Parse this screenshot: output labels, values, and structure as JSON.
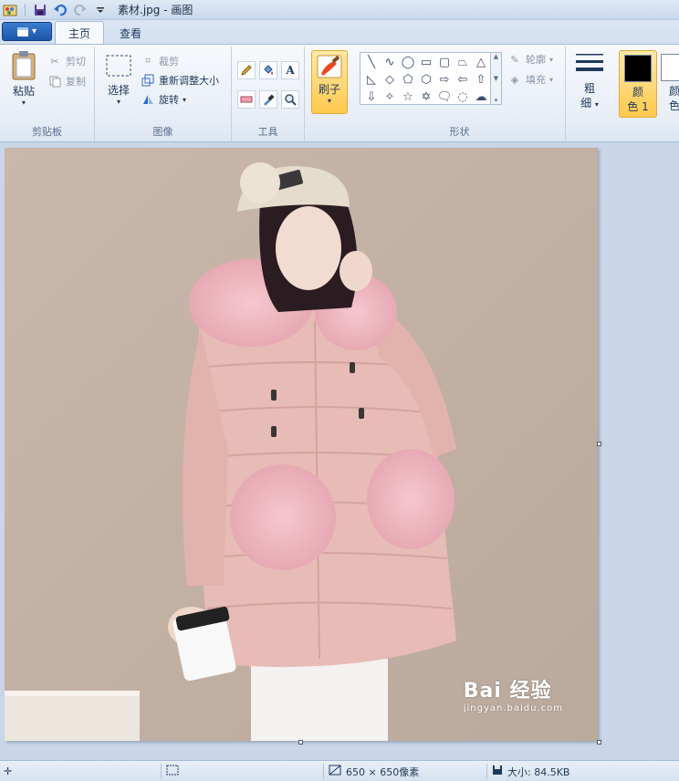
{
  "titlebar": {
    "title": "素材.jpg - 画图",
    "icons": [
      "paint-app-icon",
      "save-icon",
      "undo-icon",
      "redo-icon",
      "customize-dropdown-icon"
    ]
  },
  "tabs": [
    {
      "label": "主页",
      "active": true
    },
    {
      "label": "查看",
      "active": false
    }
  ],
  "ribbon": {
    "clipboard": {
      "group_label": "剪贴板",
      "paste": "粘贴",
      "cut": "剪切",
      "copy": "复制"
    },
    "image": {
      "group_label": "图像",
      "select": "选择",
      "crop": "裁剪",
      "resize": "重新调整大小",
      "rotate": "旋转"
    },
    "tools": {
      "group_label": "工具",
      "items": [
        "pencil-icon",
        "fill-icon",
        "text-icon",
        "eraser-icon",
        "color-picker-icon",
        "magnifier-icon"
      ]
    },
    "brushes": {
      "label": "刷子"
    },
    "shapes": {
      "group_label": "形状",
      "outline": "轮廓",
      "fill": "填充"
    },
    "size": {
      "label_line1": "粗",
      "label_line2": "细"
    },
    "color1": {
      "label_line1": "颜",
      "label_line2": "色 1",
      "color": "#000000"
    },
    "color2": {
      "label_line1": "颜",
      "label_line2": "色",
      "color": "#ffffff"
    }
  },
  "statusbar": {
    "dimensions": "650 × 650像素",
    "size": "大小: 84.5KB"
  },
  "watermark": {
    "main": "Bai 经验",
    "sub": "jingyan.baidu.com"
  }
}
